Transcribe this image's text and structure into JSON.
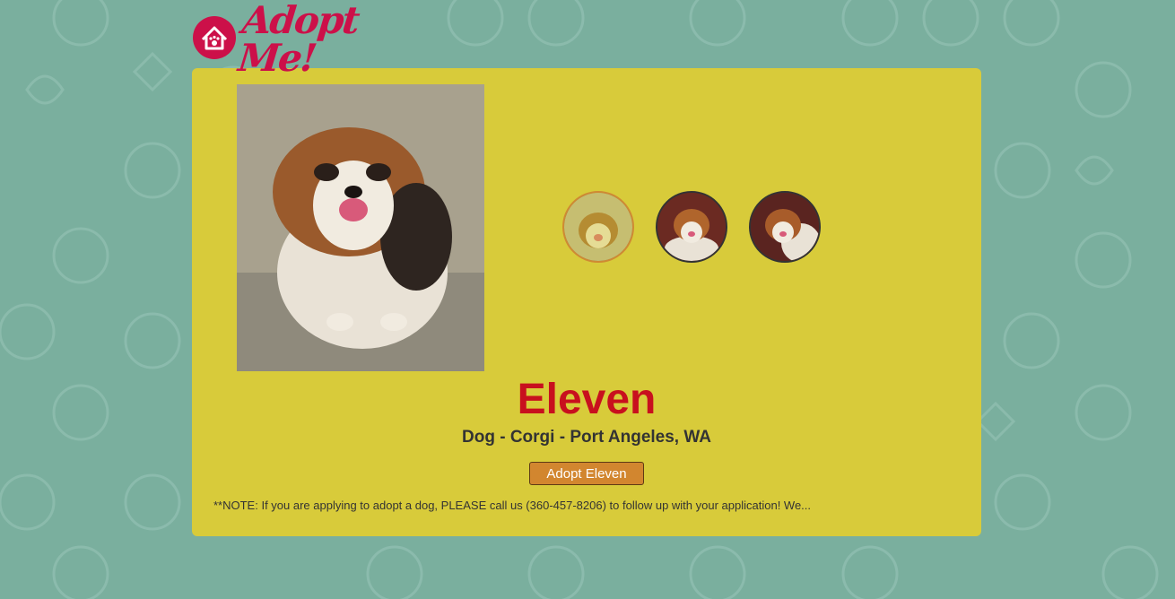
{
  "header": {
    "logo_text": "Adopt Me!",
    "logo_icon": "house-paw-icon"
  },
  "pet": {
    "name": "Eleven",
    "animal": "Dog",
    "breed": "Corgi",
    "location": "Port Angeles, WA",
    "details": "Dog - Corgi - Port Angeles, WA",
    "adopt_label": "Adopt Eleven",
    "description": "**NOTE: If you are applying to adopt a dog, PLEASE call us (360-457-8206) to follow up with your application! We..."
  },
  "gallery": {
    "active_index": 0,
    "thumbnails": [
      "photo-1",
      "photo-2",
      "photo-3"
    ]
  },
  "colors": {
    "background": "#7aaf9e",
    "card": "#d8cb3a",
    "brand": "#cc1049",
    "name": "#c8101e",
    "button": "#d2862f"
  }
}
